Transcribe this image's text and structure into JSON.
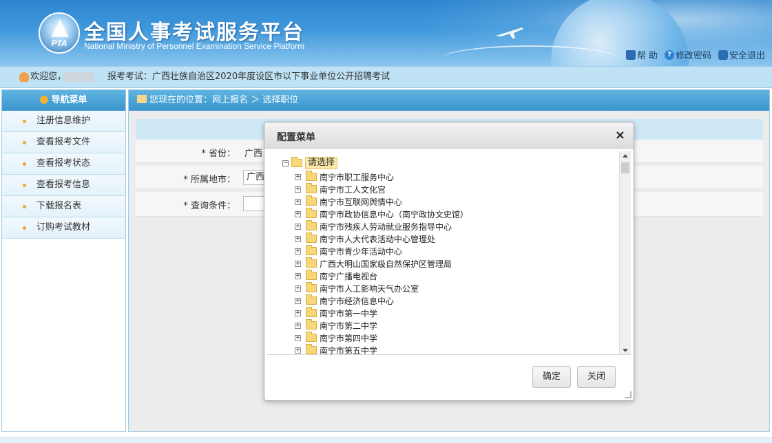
{
  "header": {
    "title": "全国人事考试服务平台",
    "subtitle": "National Ministry of Personnel Examination Service Platform",
    "logo_text": "PTA",
    "links": [
      {
        "label": "帮 助",
        "icon": "lock-icon"
      },
      {
        "label": "修改密码",
        "icon": "question-icon"
      },
      {
        "label": "安全退出",
        "icon": "exit-icon"
      }
    ]
  },
  "welcome": {
    "greeting": "欢迎您，",
    "exam": "报考考试：广西壮族自治区2020年度设区市以下事业单位公开招聘考试"
  },
  "sidebar": {
    "title": "导航菜单",
    "items": [
      {
        "label": "注册信息维护"
      },
      {
        "label": "查看报考文件"
      },
      {
        "label": "查看报考状态"
      },
      {
        "label": "查看报考信息"
      },
      {
        "label": "下载报名表"
      },
      {
        "label": "订购考试教材"
      }
    ]
  },
  "breadcrumb": {
    "text": "您现在的位置：网上报名 ＞ 选择职位"
  },
  "form": {
    "province_label": "* 省份：",
    "province_value": "广西",
    "city_label": "* 所属地市：",
    "city_value": "广西",
    "query_label": "* 查询条件："
  },
  "modal": {
    "title": "配置菜单",
    "close_glyph": "×",
    "root_label": "请选择",
    "nodes": [
      "南宁市职工服务中心",
      "南宁市工人文化宫",
      "南宁市互联网舆情中心",
      "南宁市政协信息中心（南宁政协文史馆）",
      "南宁市残疾人劳动就业服务指导中心",
      "南宁市人大代表活动中心管理处",
      "南宁市青少年活动中心",
      "广西大明山国家级自然保护区管理局",
      "南宁广播电视台",
      "南宁市人工影响天气办公室",
      "南宁市经济信息中心",
      "南宁市第一中学",
      "南宁市第二中学",
      "南宁市第四中学",
      "南宁市第五中学"
    ],
    "confirm_label": "确定",
    "close_label": "关闭"
  },
  "colors": {
    "header_blue": "#3f98dc",
    "nav_blue": "#3a95cd",
    "welcome_bg": "#bfe3f5"
  }
}
